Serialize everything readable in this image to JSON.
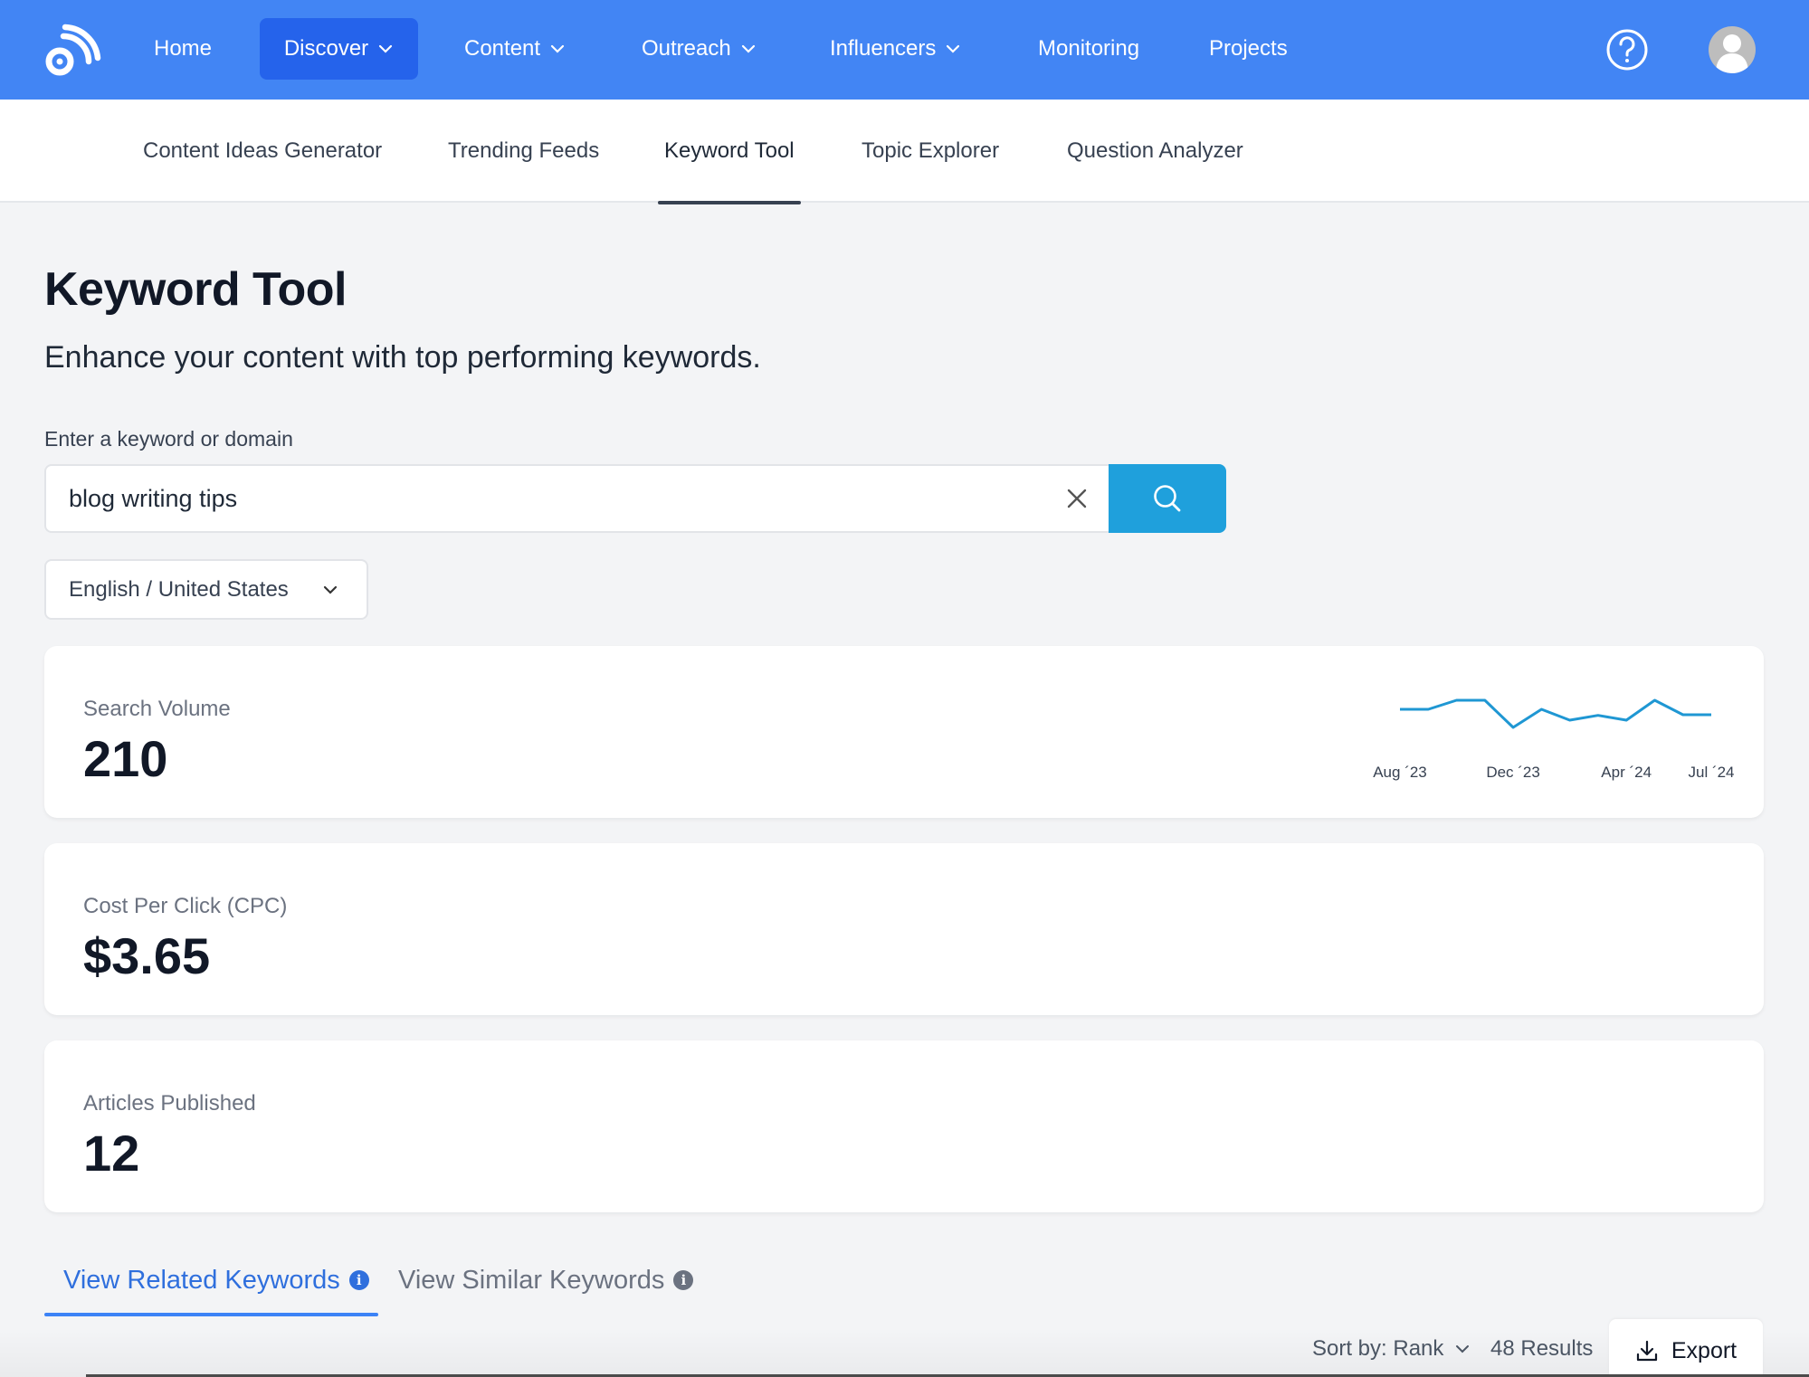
{
  "topnav": {
    "logo": "feed-logo",
    "items": [
      {
        "label": "Home",
        "has_dropdown": false,
        "active": false
      },
      {
        "label": "Discover",
        "has_dropdown": true,
        "active": true
      },
      {
        "label": "Content",
        "has_dropdown": true,
        "active": false
      },
      {
        "label": "Outreach",
        "has_dropdown": true,
        "active": false
      },
      {
        "label": "Influencers",
        "has_dropdown": true,
        "active": false
      },
      {
        "label": "Monitoring",
        "has_dropdown": false,
        "active": false
      },
      {
        "label": "Projects",
        "has_dropdown": false,
        "active": false
      }
    ],
    "help_icon": "question-circle-icon",
    "avatar_icon": "user-avatar-icon",
    "colors": {
      "bar": "#4285f4",
      "active": "#2563eb"
    }
  },
  "subnav": {
    "items": [
      {
        "label": "Content Ideas Generator",
        "active": false
      },
      {
        "label": "Trending Feeds",
        "active": false
      },
      {
        "label": "Keyword Tool",
        "active": true
      },
      {
        "label": "Topic Explorer",
        "active": false
      },
      {
        "label": "Question Analyzer",
        "active": false
      }
    ]
  },
  "page": {
    "title": "Keyword Tool",
    "subtitle": "Enhance your content with top performing keywords."
  },
  "search": {
    "label": "Enter a keyword or domain",
    "value": "blog writing tips",
    "placeholder": "",
    "clear_icon": "close-icon",
    "search_icon": "search-icon",
    "button_color": "#1fa0dc"
  },
  "locale": {
    "selected": "English / United States"
  },
  "metrics": [
    {
      "label": "Search Volume",
      "value": "210"
    },
    {
      "label": "Cost Per Click (CPC)",
      "value": "$3.65"
    },
    {
      "label": "Articles Published",
      "value": "12"
    }
  ],
  "chart_data": {
    "type": "line",
    "title": "",
    "xlabel": "",
    "ylabel": "",
    "x": [
      "Aug '23",
      "Sep '23",
      "Oct '23",
      "Nov '23",
      "Dec '23",
      "Jan '24",
      "Feb '24",
      "Mar '24",
      "Apr '24",
      "May '24",
      "Jun '24",
      "Jul '24"
    ],
    "tick_labels": [
      "Aug ´23",
      "Dec ´23",
      "Apr ´24",
      "Jul ´24"
    ],
    "tick_indices": [
      0,
      4,
      8,
      11
    ],
    "series": [
      {
        "name": "Search Volume",
        "values": [
          215,
          215,
          230,
          230,
          185,
          215,
          197,
          205,
          197,
          230,
          206,
          206
        ],
        "color": "#1f97d3"
      }
    ],
    "ylim": [
      170,
      245
    ],
    "grid": false,
    "legend": "none"
  },
  "tabs": [
    {
      "label": "View Related Keywords",
      "active": true,
      "icon": "info-icon"
    },
    {
      "label": "View Similar Keywords",
      "active": false,
      "icon": "info-icon"
    }
  ],
  "results_toolbar": {
    "sort_label": "Sort by: Rank",
    "results_count": "48 Results",
    "export_label": "Export",
    "export_icon": "download-icon"
  }
}
